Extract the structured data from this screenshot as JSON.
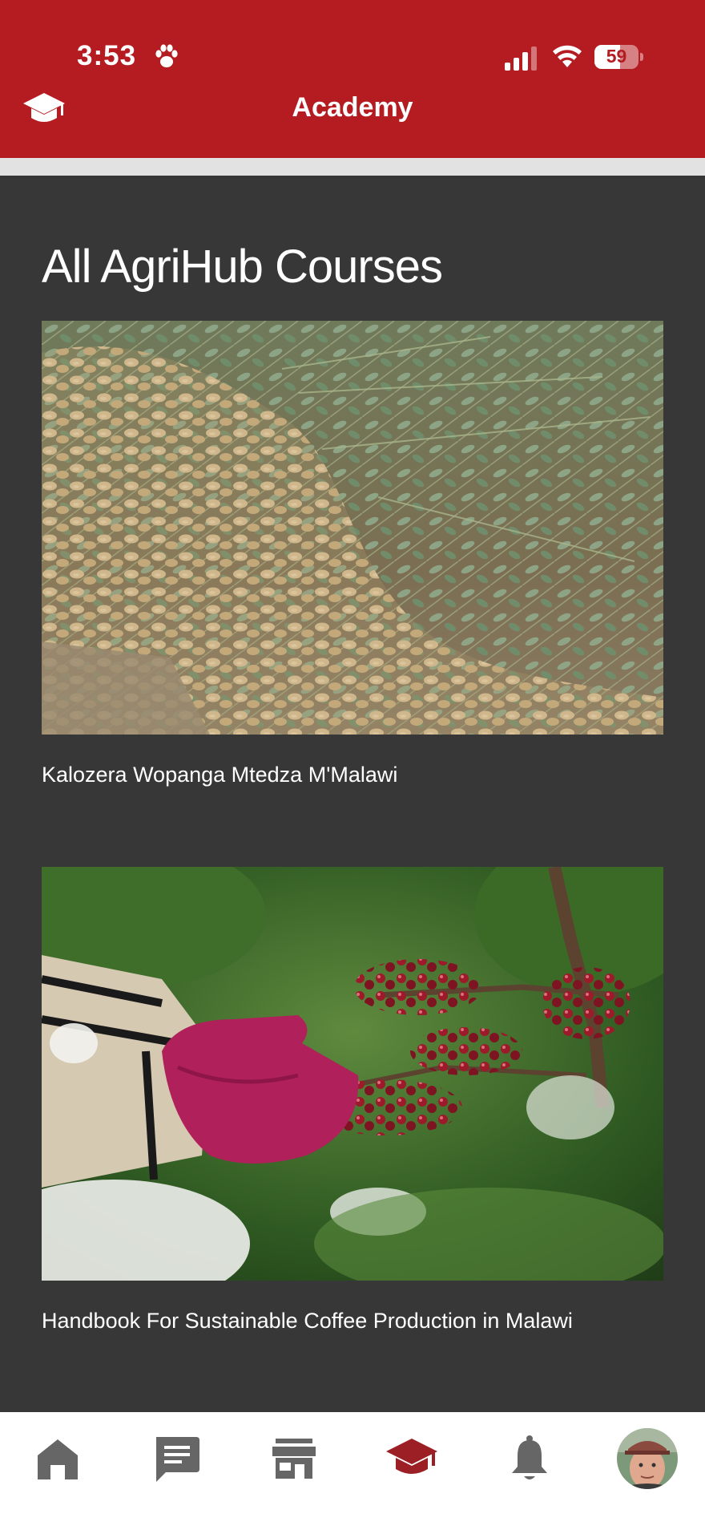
{
  "status_bar": {
    "time": "3:53",
    "battery": "59",
    "battery_level": 0.59
  },
  "header": {
    "title": "Academy",
    "icon": "graduation-cap-icon",
    "color": "#b41c22"
  },
  "main": {
    "section_title": "All AgriHub Courses",
    "courses": [
      {
        "title": "Kalozera Wopanga Mtedza M'Malawi",
        "image": "peanut-harvest-photo"
      },
      {
        "title": "Handbook For Sustainable Coffee Production in Malawi",
        "image": "coffee-cherry-picking-photo"
      }
    ]
  },
  "tab_bar": {
    "active_color": "#9b1f24",
    "inactive_color": "#666666",
    "items": [
      {
        "icon": "home-icon",
        "active": false
      },
      {
        "icon": "chat-icon",
        "active": false
      },
      {
        "icon": "store-icon",
        "active": false
      },
      {
        "icon": "graduation-cap-icon",
        "active": true
      },
      {
        "icon": "bell-icon",
        "active": false
      },
      {
        "icon": "profile-avatar",
        "active": false
      }
    ]
  }
}
